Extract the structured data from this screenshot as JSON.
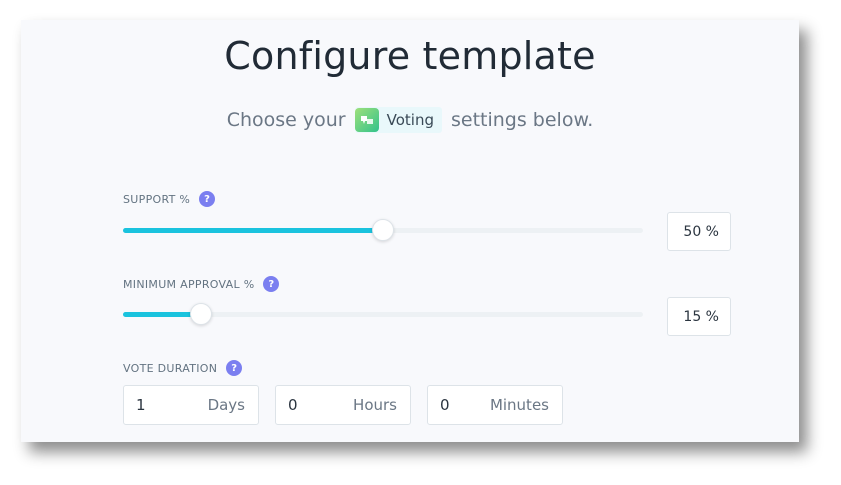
{
  "title": "Configure template",
  "subtitle": {
    "prefix": "Choose your",
    "app_name": "Voting",
    "suffix": "settings below."
  },
  "support": {
    "label": "SUPPORT %",
    "help": "?",
    "value": 50,
    "value_text": "50 %"
  },
  "min_approval": {
    "label": "MINIMUM APPROVAL %",
    "help": "?",
    "value": 15,
    "value_text": "15 %"
  },
  "vote_duration": {
    "label": "VOTE DURATION",
    "help": "?",
    "days": {
      "value": "1",
      "unit": "Days"
    },
    "hours": {
      "value": "0",
      "unit": "Hours"
    },
    "minutes": {
      "value": "0",
      "unit": "Minutes"
    }
  },
  "colors": {
    "accent": "#1ac3de",
    "help_icon": "#7b7ff0",
    "app_icon": "#33c28b"
  }
}
